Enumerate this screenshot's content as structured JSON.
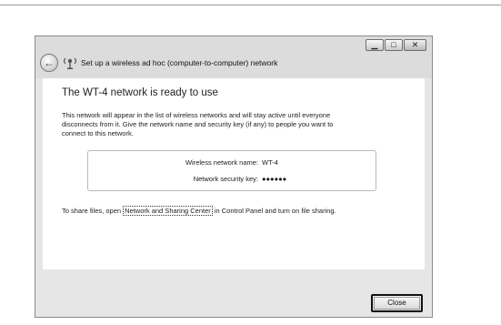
{
  "window": {
    "title": "Set up a wireless ad hoc (computer-to-computer) network",
    "controls": {
      "minimize": "▁",
      "maximize": "□",
      "close": "✕"
    }
  },
  "content": {
    "heading": "The WT-4 network is ready to use",
    "description": "This network will appear in the list of wireless networks and will stay active until everyone disconnects from it. Give the network name and security key (if any) to people you want to connect to this network.",
    "network_name_label": "Wireless network name:",
    "network_name_value": "WT-4",
    "security_key_label": "Network security key:",
    "security_key_value": "●●●●●●",
    "share_prefix": "To share files, open ",
    "share_link": "Network and Sharing Center",
    "share_suffix": " in Control Panel and turn on file sharing."
  },
  "footer": {
    "close_label": "Close"
  },
  "icons": {
    "back": "back-arrow-icon",
    "wizard": "wireless-network-icon"
  }
}
